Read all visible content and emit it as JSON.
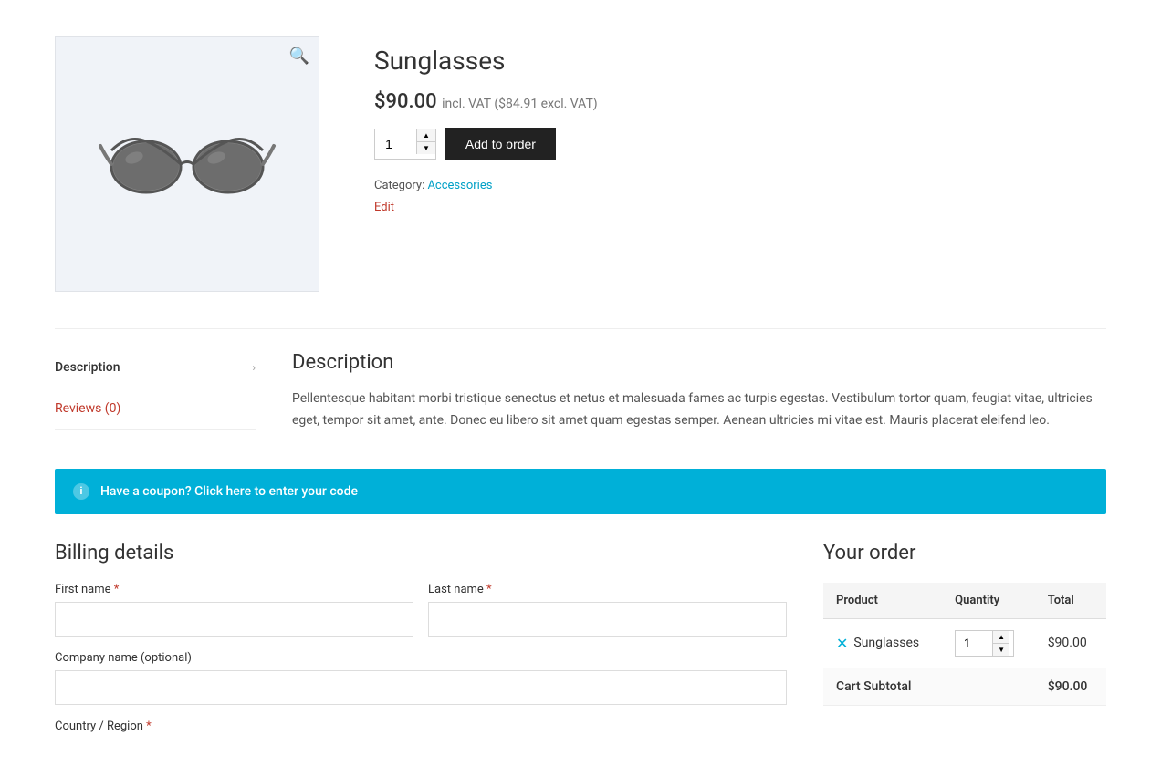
{
  "product": {
    "title": "Sunglasses",
    "price": "$90.00",
    "incl_vat": "incl. VAT",
    "excl_vat": "($84.91 excl. VAT)",
    "quantity": "1",
    "add_to_order_label": "Add to order",
    "category_label": "Category:",
    "category_name": "Accessories",
    "edit_label": "Edit"
  },
  "tabs": {
    "description_tab": "Description",
    "reviews_tab": "Reviews (0)",
    "content_title": "Description",
    "content_text": "Pellentesque habitant morbi tristique senectus et netus et malesuada fames ac turpis egestas. Vestibulum tortor quam, feugiat vitae, ultricies eget, tempor sit amet, ante. Donec eu libero sit amet quam egestas semper. Aenean ultricies mi vitae est. Mauris placerat eleifend leo."
  },
  "coupon": {
    "text": "Have a coupon? Click here to enter your code",
    "icon": "i"
  },
  "billing": {
    "title": "Billing details",
    "first_name_label": "First name",
    "last_name_label": "Last name",
    "company_name_label": "Company name (optional)",
    "country_label": "Country / Region",
    "required_marker": " *"
  },
  "order": {
    "title": "Your order",
    "col_product": "Product",
    "col_quantity": "Quantity",
    "col_total": "Total",
    "product_name": "Sunglasses",
    "product_qty": "1",
    "product_total": "$90.00",
    "subtotal_label": "Cart Subtotal",
    "subtotal_value": "$90.00"
  },
  "icons": {
    "zoom": "🔍",
    "chevron": "›",
    "remove": "✕",
    "info": "i"
  }
}
